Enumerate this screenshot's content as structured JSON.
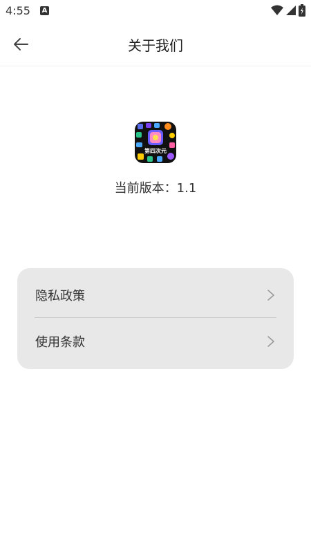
{
  "status_bar": {
    "time": "4:55",
    "notification_badge": "A"
  },
  "app_bar": {
    "title": "关于我们"
  },
  "app_info": {
    "logo_text": "第四次元",
    "version": "当前版本：1.1"
  },
  "menu": {
    "items": [
      {
        "label": "隐私政策"
      },
      {
        "label": "使用条款"
      }
    ]
  },
  "colors": {
    "background": "#ffffff",
    "card": "#e8e8e8",
    "divider": "#c8c8c8",
    "text": "#333333"
  }
}
